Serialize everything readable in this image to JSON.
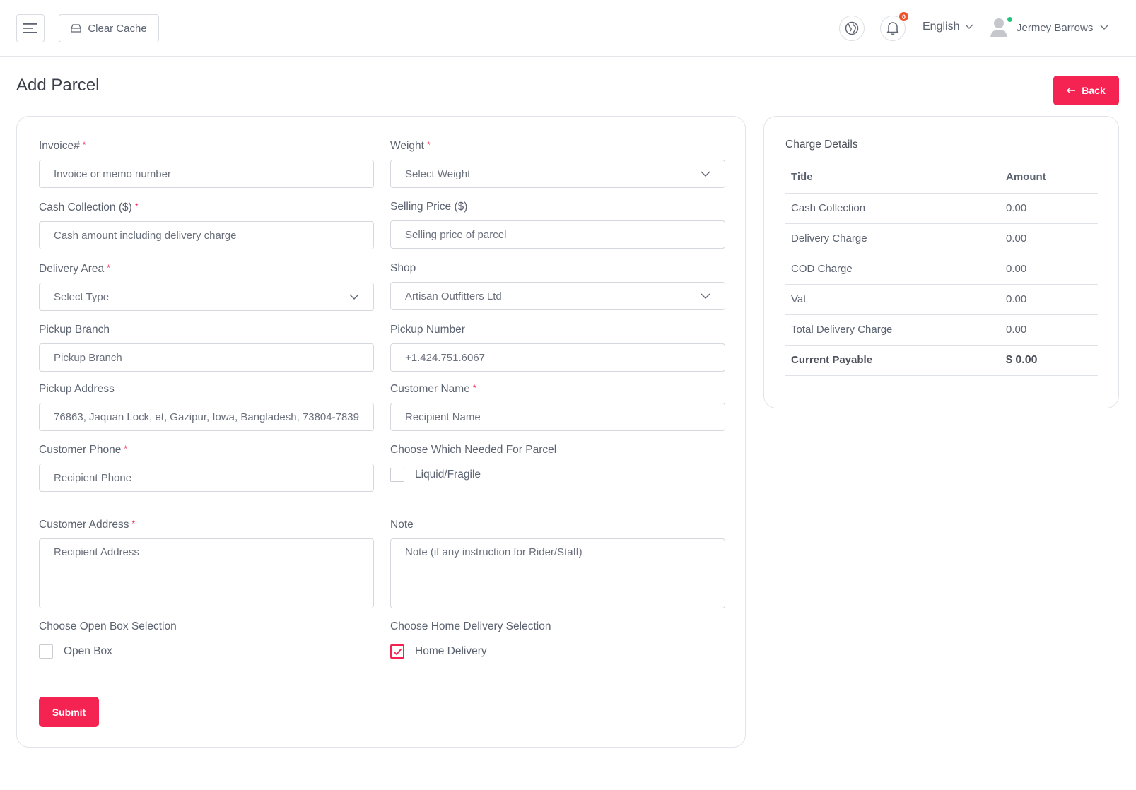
{
  "header": {
    "clear_cache_label": "Clear Cache",
    "notification_count": "0",
    "language": "English",
    "user_name": "Jermey Barrows"
  },
  "page": {
    "title": "Add Parcel",
    "back_label": "Back"
  },
  "form": {
    "invoice": {
      "label": "Invoice#",
      "required": "*",
      "placeholder": "Invoice or memo number"
    },
    "weight": {
      "label": "Weight",
      "required": "*",
      "value": "Select Weight"
    },
    "cash_collection": {
      "label": "Cash Collection ($)",
      "required": "*",
      "placeholder": "Cash amount including delivery charge"
    },
    "selling_price": {
      "label": "Selling Price ($)",
      "placeholder": "Selling price of parcel"
    },
    "delivery_area": {
      "label": "Delivery Area",
      "required": "*",
      "value": "Select Type"
    },
    "shop": {
      "label": "Shop",
      "value": "Artisan Outfitters Ltd"
    },
    "pickup_branch": {
      "label": "Pickup Branch",
      "placeholder": "Pickup Branch"
    },
    "pickup_number": {
      "label": "Pickup Number",
      "value": "+1.424.751.6067"
    },
    "pickup_address": {
      "label": "Pickup Address",
      "value": "76863, Jaquan Lock, et, Gazipur, Iowa, Bangladesh, 73804-7839"
    },
    "customer_name": {
      "label": "Customer Name",
      "required": "*",
      "placeholder": "Recipient Name"
    },
    "customer_phone": {
      "label": "Customer Phone",
      "required": "*",
      "placeholder": "Recipient Phone"
    },
    "parcel_needs": {
      "label": "Choose Which Needed For Parcel",
      "option": "Liquid/Fragile",
      "checked": false
    },
    "customer_address": {
      "label": "Customer Address",
      "required": "*",
      "placeholder": "Recipient Address"
    },
    "note": {
      "label": "Note",
      "placeholder": "Note (if any instruction for Rider/Staff)"
    },
    "open_box": {
      "label": "Choose Open Box Selection",
      "option": "Open Box",
      "checked": false
    },
    "home_delivery": {
      "label": "Choose Home Delivery Selection",
      "option": "Home Delivery",
      "checked": true
    },
    "submit_label": "Submit"
  },
  "charge_details": {
    "title": "Charge Details",
    "columns": {
      "title": "Title",
      "amount": "Amount"
    },
    "rows": [
      {
        "title": "Cash Collection",
        "amount": "0.00"
      },
      {
        "title": "Delivery Charge",
        "amount": "0.00"
      },
      {
        "title": "COD Charge",
        "amount": "0.00"
      },
      {
        "title": "Vat",
        "amount": "0.00"
      },
      {
        "title": "Total Delivery Charge",
        "amount": "0.00"
      }
    ],
    "total": {
      "title": "Current Payable",
      "amount": "$ 0.00"
    }
  },
  "colors": {
    "accent": "#f52352",
    "badge": "#f0542d",
    "online": "#1fc57a"
  }
}
